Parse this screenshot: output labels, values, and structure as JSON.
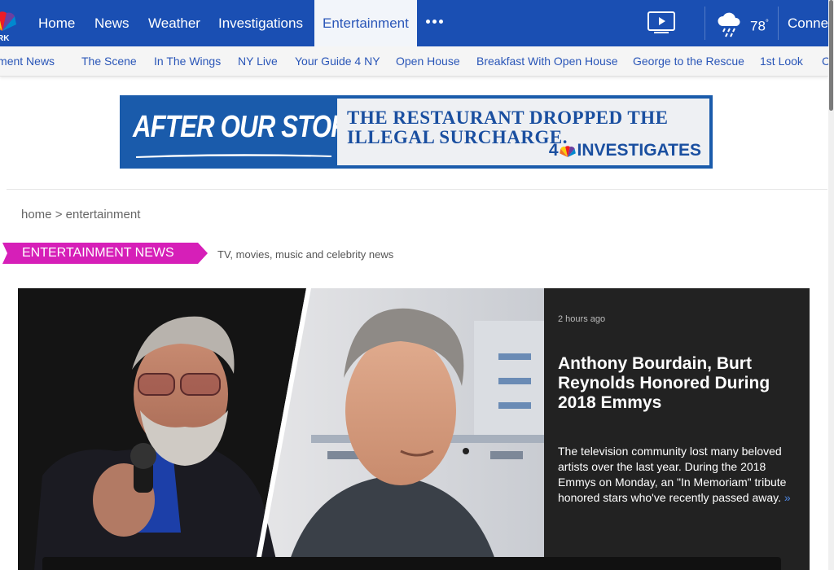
{
  "brand": {
    "logo_text": "RK",
    "colors": {
      "primary": "#1a4fb3",
      "accent": "#d61fb8",
      "link": "#2a56b8"
    }
  },
  "topnav": {
    "items": [
      {
        "label": "Home"
      },
      {
        "label": "News"
      },
      {
        "label": "Weather"
      },
      {
        "label": "Investigations"
      },
      {
        "label": "Entertainment",
        "active": true
      }
    ],
    "more_icon": "more-dots-icon",
    "video_icon": "video-play-icon",
    "weather_icon": "rain-cloud-icon",
    "temperature": "78",
    "temperature_unit": "°",
    "connect_label": "Connect"
  },
  "subnav": {
    "items": [
      {
        "label": "Entertainment News"
      },
      {
        "label": "The Scene"
      },
      {
        "label": "In The Wings"
      },
      {
        "label": "NY Live"
      },
      {
        "label": "Your Guide 4 NY"
      },
      {
        "label": "Open House"
      },
      {
        "label": "Breakfast With Open House"
      },
      {
        "label": "George to the Rescue"
      },
      {
        "label": "1st Look"
      },
      {
        "label": "CO"
      }
    ]
  },
  "ad": {
    "headline": "AFTER OUR STORY,",
    "subtext_line1": "THE RESTAURANT DROPPED THE",
    "subtext_line2": "ILLEGAL SURCHARGE.",
    "brand_number": "4",
    "brand_name": "INVESTIGATES"
  },
  "breadcrumb": {
    "home": "home",
    "separator": ">",
    "current": "entertainment"
  },
  "section": {
    "title": "ENTERTAINMENT NEWS",
    "description": "TV, movies, music and celebrity news"
  },
  "hero": {
    "timestamp": "2 hours ago",
    "headline": "Anthony Bourdain, Burt Reynolds Honored During 2018 Emmys",
    "summary": "The television community lost many beloved artists over the last year. During the 2018 Emmys on Monday, an \"In Memoriam\" tribute honored stars who've recently passed away.",
    "more_glyph": "»"
  }
}
